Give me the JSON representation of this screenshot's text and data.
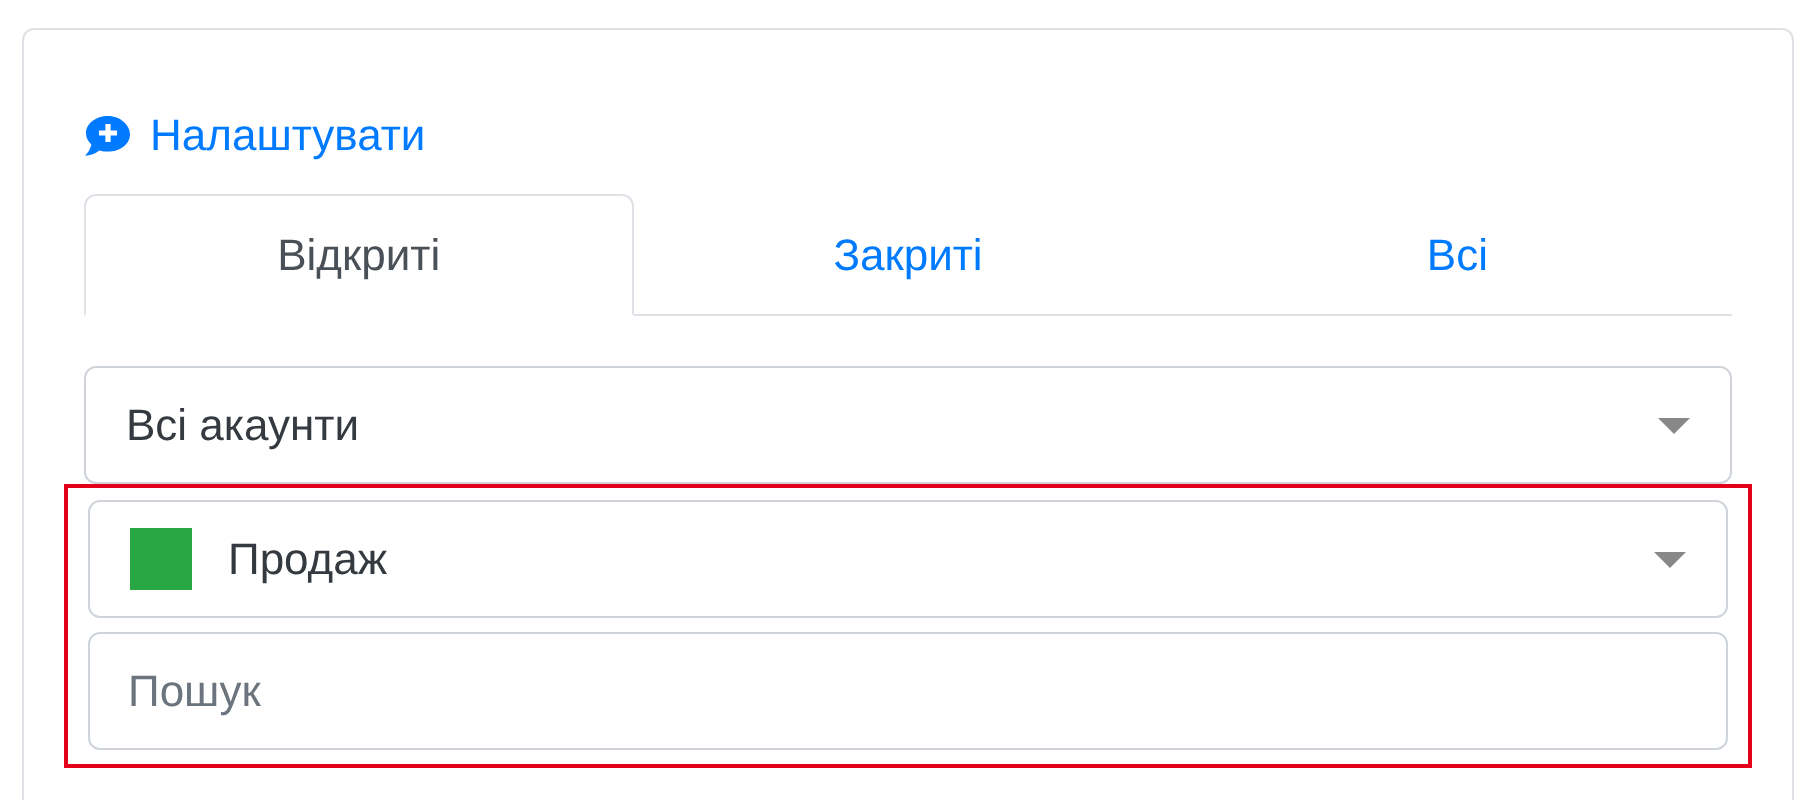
{
  "configure_link": {
    "label": "Налаштувати"
  },
  "tabs": [
    {
      "label": "Відкриті",
      "selected": true
    },
    {
      "label": "Закриті",
      "selected": false
    },
    {
      "label": "Всі",
      "selected": false
    }
  ],
  "account_select": {
    "value": "Всі акаунти"
  },
  "filter_group": {
    "highlighted": true,
    "stage_select": {
      "value": "Продаж",
      "color": "#28a745"
    },
    "search": {
      "placeholder": "Пошук"
    }
  }
}
